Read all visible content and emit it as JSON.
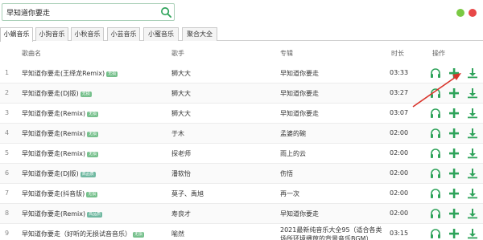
{
  "search": {
    "value": "早知道你要走"
  },
  "tabs": [
    {
      "label": "小蜗音乐",
      "active": true
    },
    {
      "label": "小狗音乐",
      "active": false
    },
    {
      "label": "小秋音乐",
      "active": false
    },
    {
      "label": "小芸音乐",
      "active": false
    },
    {
      "label": "小蜜音乐",
      "active": false
    },
    {
      "label": "聚合大全",
      "active": false
    }
  ],
  "table": {
    "headers": {
      "name": "歌曲名",
      "artist": "歌手",
      "album": "专辑",
      "duration": "时长",
      "actions": "操作"
    },
    "rows": [
      {
        "num": "1",
        "name": "早知道你要走(王绎龙Remix)",
        "badge": "无损",
        "artist": "狮大大",
        "album": "早知道你要走",
        "duration": "03:33"
      },
      {
        "num": "2",
        "name": "早知道你要走(DJ版)",
        "badge": "无损",
        "artist": "狮大大",
        "album": "早知道你要走",
        "duration": "03:27"
      },
      {
        "num": "3",
        "name": "早知道你要走(Remix)",
        "badge": "无损",
        "artist": "狮大大",
        "album": "早知道你要走",
        "duration": "03:07"
      },
      {
        "num": "4",
        "name": "早知道你要走(Remix)",
        "badge": "无损",
        "artist": "于木",
        "album": "孟婆的碗",
        "duration": "02:00"
      },
      {
        "num": "5",
        "name": "早知道你要走(Remix)",
        "badge": "无损",
        "artist": "探老师",
        "album": "雨上的云",
        "duration": "02:00"
      },
      {
        "num": "6",
        "name": "早知道你要走(DJ版)",
        "badge": "高品质",
        "artist": "潘软怡",
        "album": "伤悟",
        "duration": "02:00"
      },
      {
        "num": "7",
        "name": "早知道你要走(抖音版)",
        "badge": "无损",
        "artist": "莫子、禹旭",
        "album": "再一次",
        "duration": "02:00"
      },
      {
        "num": "8",
        "name": "早知道你要走(Remix)",
        "badge": "高品质",
        "artist": "寿良才",
        "album": "早知道你要走",
        "duration": "02:00"
      },
      {
        "num": "9",
        "name": "早知道你要走（好听的无损试音音乐）",
        "badge": "无损",
        "artist": "喻然",
        "album": "2021最新纯音乐大全95（适合各类场所环境播放的背景音乐BGM）",
        "duration": "03:15"
      }
    ]
  },
  "icons": {
    "listen": "headphones-icon",
    "add": "plus-icon",
    "download": "download-icon",
    "search": "search-icon"
  },
  "colors": {
    "accent": "#2ea35a",
    "badge_lossless": "#76c08c",
    "badge_hq": "#6fb8a0",
    "arrow": "#d9342b"
  }
}
